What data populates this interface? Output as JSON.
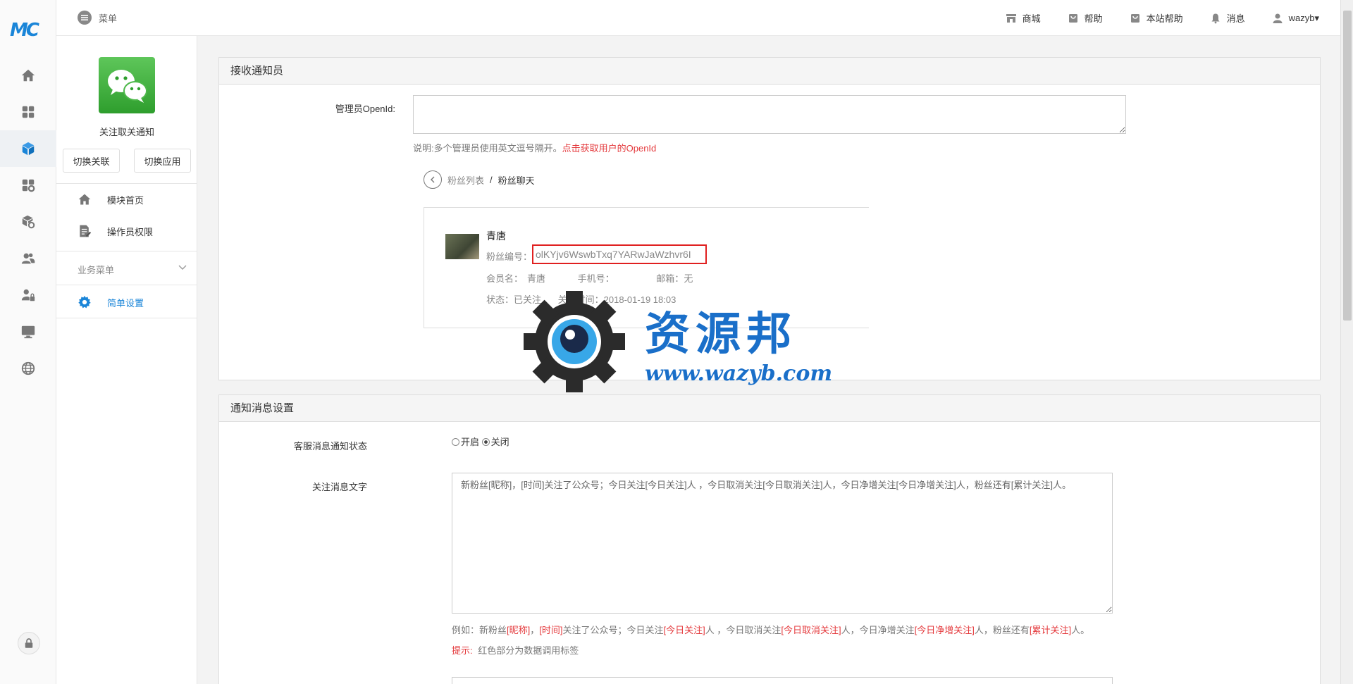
{
  "app": {
    "logo_text": "MC"
  },
  "rail": {
    "items": [
      {
        "icon": "home-icon"
      },
      {
        "icon": "grid-icon"
      },
      {
        "icon": "cube-icon",
        "active": true
      },
      {
        "icon": "apps-gear-icon"
      },
      {
        "icon": "package-icon"
      },
      {
        "icon": "users-icon"
      },
      {
        "icon": "user-lock-icon"
      },
      {
        "icon": "monitor-icon"
      },
      {
        "icon": "globe-icon"
      }
    ],
    "lock_icon": "lock-icon"
  },
  "topbar": {
    "menu_label": "菜单",
    "nav": [
      {
        "label": "商城",
        "icon": "store-icon"
      },
      {
        "label": "帮助",
        "icon": "bag-icon"
      },
      {
        "label": "本站帮助",
        "icon": "bag-icon"
      },
      {
        "label": "消息",
        "icon": "bell-icon"
      },
      {
        "label": "wazyb▾",
        "icon": "user-icon"
      }
    ]
  },
  "sidebar": {
    "app_title": "关注取关通知",
    "switch_link_label": "切换关联",
    "switch_app_label": "切换应用",
    "nav_items": [
      {
        "label": "模块首页",
        "icon": "home-icon"
      },
      {
        "label": "操作员权限",
        "icon": "document-edit-icon"
      }
    ],
    "group_label": "业务菜单",
    "group_items": [
      {
        "label": "简单设置",
        "icon": "gear-icon",
        "active": true
      }
    ]
  },
  "panel_receivers": {
    "title": "接收通知员",
    "openid_label": "管理员OpenId:",
    "openid_value": "",
    "note_prefix": "说明:多个管理员使用英文逗号隔开。",
    "note_link": "点击获取用户的OpenId",
    "breadcrumb": {
      "parent": "粉丝列表",
      "sep": "/",
      "current": "粉丝聊天"
    },
    "fan": {
      "name": "青唐",
      "id_label": "粉丝编号：",
      "id_value": "olKYjv6WswbTxq7YARwJaWzhvr6I",
      "member_label": "会员名：",
      "member_value": "青唐",
      "phone_label": "手机号：",
      "phone_value": "",
      "email_label": "邮箱：",
      "email_value": "无",
      "status_label": "状态：",
      "status_value": "已关注",
      "time_label": "关注时间：",
      "time_value": "2018-01-19 18:03"
    }
  },
  "panel_settings": {
    "title": "通知消息设置",
    "status_label": "客服消息通知状态",
    "radio_on": "开启",
    "radio_off": "关闭",
    "selected": "关闭",
    "text_label": "关注消息文字",
    "text_value": "新粉丝[昵称]，[时间]关注了公众号；今日关注[今日关注]人 ，今日取消关注[今日取消关注]人，今日净增关注[今日净增关注]人，粉丝还有[累计关注]人。",
    "example": [
      {
        "t": "例如：新粉丝",
        "red": false
      },
      {
        "t": "[昵称]",
        "red": true
      },
      {
        "t": "，",
        "red": false
      },
      {
        "t": "[时间]",
        "red": true
      },
      {
        "t": "关注了公众号；今日关注",
        "red": false
      },
      {
        "t": "[今日关注]",
        "red": true
      },
      {
        "t": "人 ，今日取消关注",
        "red": false
      },
      {
        "t": "[今日取消关注]",
        "red": true
      },
      {
        "t": "人，今日净增关注",
        "red": false
      },
      {
        "t": "[今日净增关注]",
        "red": true
      },
      {
        "t": "人，粉丝还有",
        "red": false
      },
      {
        "t": "[累计关注]",
        "red": true
      },
      {
        "t": "人。",
        "red": false
      }
    ],
    "tip_label": "提示:",
    "tip_text": "红色部分为数据调用标签"
  },
  "watermark": {
    "title": "资源邦",
    "url": "www.wazyb.com"
  },
  "colors": {
    "accent": "#1a85d8",
    "danger": "#e4393c"
  }
}
